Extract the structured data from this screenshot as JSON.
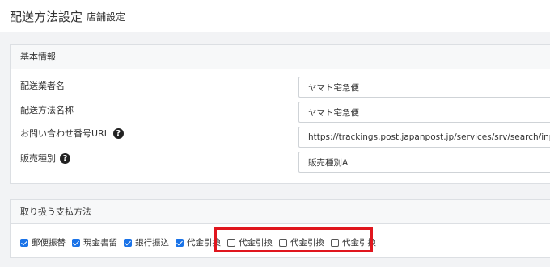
{
  "header": {
    "title": "配送方法設定",
    "subtitle": "店舗設定"
  },
  "basic_info": {
    "section_title": "基本情報",
    "fields": [
      {
        "label": "配送業者名",
        "value": "ヤマト宅急便",
        "help": false
      },
      {
        "label": "配送方法名称",
        "value": "ヤマト宅急便",
        "help": false
      },
      {
        "label": "お問い合わせ番号URL",
        "value": "https://trackings.post.japanpost.jp/services/srv/search/input",
        "help": true
      },
      {
        "label": "販売種別",
        "value": "販売種別A",
        "help": true
      }
    ],
    "help_icon": "question-circle-icon"
  },
  "payment_methods": {
    "section_title": "取り扱う支払方法",
    "options": [
      {
        "label": "郵便振替",
        "checked": true
      },
      {
        "label": "現金書留",
        "checked": true
      },
      {
        "label": "銀行振込",
        "checked": true
      },
      {
        "label": "代金引換",
        "checked": true
      },
      {
        "label": "代金引換",
        "checked": false
      },
      {
        "label": "代金引換",
        "checked": false
      },
      {
        "label": "代金引換",
        "checked": false
      }
    ]
  },
  "colors": {
    "accent": "#1a73e8",
    "highlight": "#e0161e"
  }
}
